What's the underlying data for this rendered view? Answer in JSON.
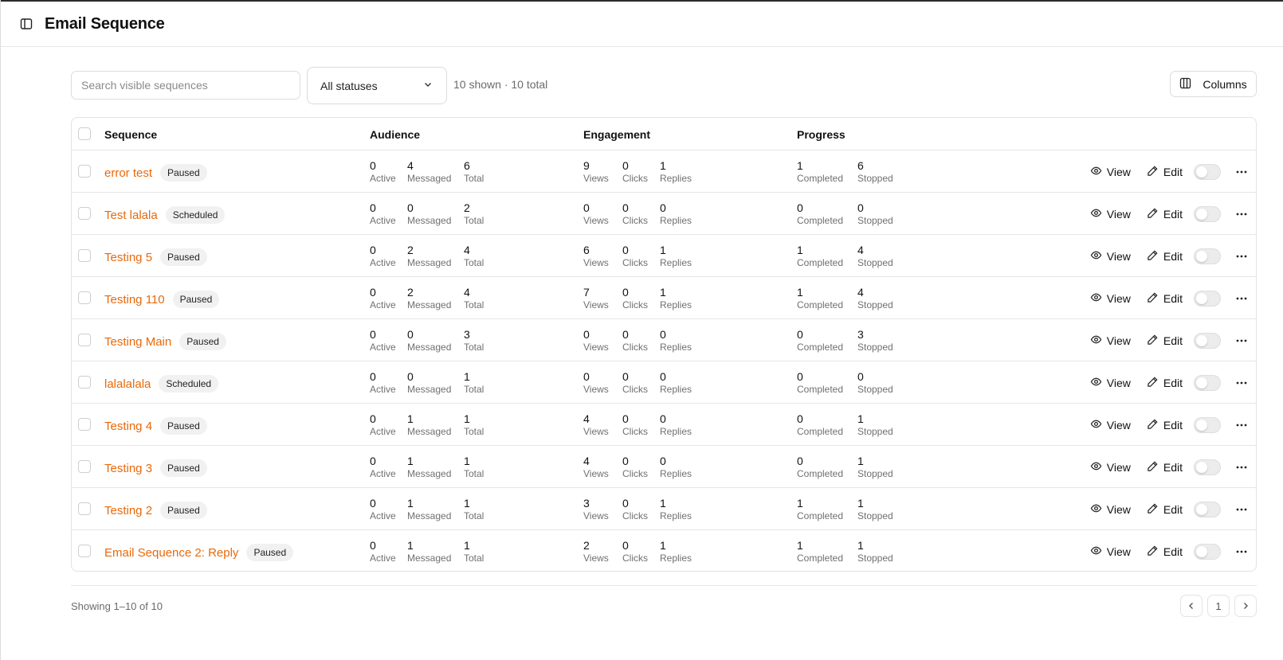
{
  "header": {
    "title": "Email Sequence"
  },
  "toolbar": {
    "search_placeholder": "Search visible sequences",
    "status_filter": "All statuses",
    "count_text": "10 shown · 10 total",
    "columns_label": "Columns"
  },
  "table": {
    "headers": {
      "sequence": "Sequence",
      "audience": "Audience",
      "engagement": "Engagement",
      "progress": "Progress"
    },
    "metric_labels": {
      "active": "Active",
      "messaged": "Messaged",
      "total": "Total",
      "views": "Views",
      "clicks": "Clicks",
      "replies": "Replies",
      "completed": "Completed",
      "stopped": "Stopped"
    },
    "actions": {
      "view": "View",
      "edit": "Edit"
    },
    "rows": [
      {
        "name": "error test",
        "status": "Paused",
        "active": "0",
        "messaged": "4",
        "total": "6",
        "views": "9",
        "clicks": "0",
        "replies": "1",
        "completed": "1",
        "stopped": "6"
      },
      {
        "name": "Test lalala",
        "status": "Scheduled",
        "active": "0",
        "messaged": "0",
        "total": "2",
        "views": "0",
        "clicks": "0",
        "replies": "0",
        "completed": "0",
        "stopped": "0"
      },
      {
        "name": "Testing 5",
        "status": "Paused",
        "active": "0",
        "messaged": "2",
        "total": "4",
        "views": "6",
        "clicks": "0",
        "replies": "1",
        "completed": "1",
        "stopped": "4"
      },
      {
        "name": "Testing 110",
        "status": "Paused",
        "active": "0",
        "messaged": "2",
        "total": "4",
        "views": "7",
        "clicks": "0",
        "replies": "1",
        "completed": "1",
        "stopped": "4"
      },
      {
        "name": "Testing Main",
        "status": "Paused",
        "active": "0",
        "messaged": "0",
        "total": "3",
        "views": "0",
        "clicks": "0",
        "replies": "0",
        "completed": "0",
        "stopped": "3"
      },
      {
        "name": "lalalalala",
        "status": "Scheduled",
        "active": "0",
        "messaged": "0",
        "total": "1",
        "views": "0",
        "clicks": "0",
        "replies": "0",
        "completed": "0",
        "stopped": "0"
      },
      {
        "name": "Testing 4",
        "status": "Paused",
        "active": "0",
        "messaged": "1",
        "total": "1",
        "views": "4",
        "clicks": "0",
        "replies": "0",
        "completed": "0",
        "stopped": "1"
      },
      {
        "name": "Testing 3",
        "status": "Paused",
        "active": "0",
        "messaged": "1",
        "total": "1",
        "views": "4",
        "clicks": "0",
        "replies": "0",
        "completed": "0",
        "stopped": "1"
      },
      {
        "name": "Testing 2",
        "status": "Paused",
        "active": "0",
        "messaged": "1",
        "total": "1",
        "views": "3",
        "clicks": "0",
        "replies": "1",
        "completed": "1",
        "stopped": "1"
      },
      {
        "name": "Email Sequence 2: Reply",
        "status": "Paused",
        "active": "0",
        "messaged": "1",
        "total": "1",
        "views": "2",
        "clicks": "0",
        "replies": "1",
        "completed": "1",
        "stopped": "1"
      }
    ]
  },
  "footer": {
    "showing_text": "Showing 1–10 of 10",
    "current_page": "1"
  },
  "colors": {
    "accent": "#e8690b",
    "border": "#e3e3e3",
    "muted_text": "#707070"
  },
  "icons": {
    "sidebar_toggle": "sidebar-toggle-icon",
    "dropdown": "chevron-down-icon",
    "columns": "columns-icon",
    "view": "eye-icon",
    "edit": "pencil-icon",
    "more": "more-horizontal-icon",
    "prev": "chevron-left-icon",
    "next": "chevron-right-icon"
  }
}
